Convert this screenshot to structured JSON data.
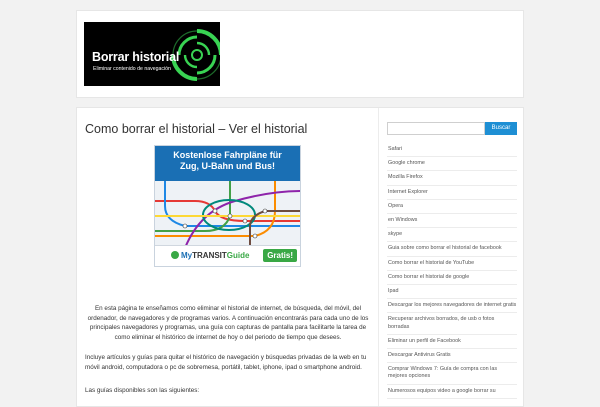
{
  "logo": {
    "title": "Borrar historial",
    "tagline": "Eliminar contenido de navegación"
  },
  "article": {
    "title": "Como borrar el historial – Ver el historial",
    "paragraphs": [
      "En esta página te enseñamos como eliminar el historial de internet, de búsqueda, del móvil, del ordenador, de navegadores y de programas varios. A continuación encontrarás para cada uno de los principales navegadores y programas, una guía con capturas de pantalla para facilitarte la tarea de como eliminar el histórico de internet de hoy o del periodo de tiempo que desees.",
      "Incluye  artículos y guías para quitar el histórico de navegación y búsquedas privadas de la web en tu móvil android, computadora o pc de sobremesa, portátil, tablet, iphone, ipad o smartphone android.",
      "Las guías disponibles son las siguientes:"
    ]
  },
  "ad": {
    "headline_1": "Kostenlose Fahrpläne für",
    "headline_2": "Zug, U-Bahn und Bus!",
    "brand_my": "My",
    "brand_transit": "TRANSIT",
    "brand_guide": "Guide",
    "cta": "Gratis!"
  },
  "sidebar": {
    "search_placeholder": "",
    "search_button": "Buscar",
    "items": [
      "Safari",
      "Google chrome",
      "Mozilla Firefox",
      "Internet Explorer",
      "Opera",
      "en Windows",
      "skype",
      "Guia sobre como borrar el historial de facebook",
      "Como borrar el historial de YouTube",
      "Como borrar el historial de google",
      "Ipad",
      "Descargar los mejores navegadores de internet gratis",
      "Recuperar archivos borrados, de usb o fotos borradas",
      "Eliminar un perfil de Facebook",
      "Descargar Antivirus Gratis",
      "Comprar Windows 7: Guía de compra con las mejores opciones",
      "Numerosos equipos video a google borrar su"
    ]
  },
  "colors": {
    "accent": "#1e8fd4",
    "logo_swirl": "#39d353",
    "ad_blue": "#1a6fb4",
    "ad_green": "#39a845"
  }
}
